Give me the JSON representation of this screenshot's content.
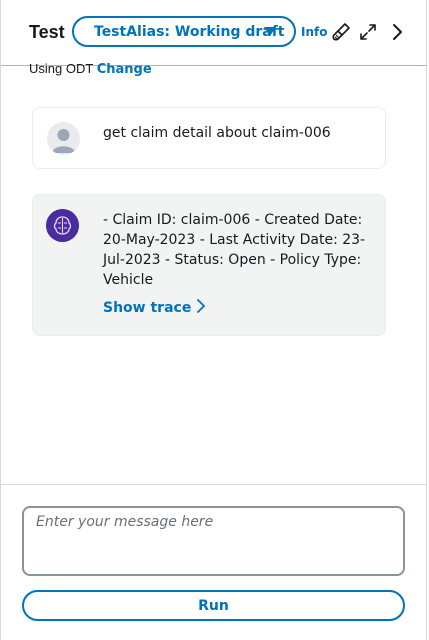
{
  "header": {
    "title": "Test",
    "alias_label": "TestAlias: Working draft",
    "info_label": "Info",
    "icons": [
      "clear-brush-icon",
      "expand-icon",
      "chevron-right-icon"
    ]
  },
  "model_row": {
    "prefix": "Using ODT",
    "change_label": "Change"
  },
  "conversation": {
    "user_message": "get claim detail about claim-006",
    "agent_message": "- Claim ID: claim-006 - Created Date: 20-May-2023 - Last Activity Date: 23-Jul-2023 - Status: Open - Policy Type: Vehicle",
    "show_trace_label": "Show trace"
  },
  "composer": {
    "placeholder": "Enter your message here",
    "run_label": "Run"
  },
  "colors": {
    "accent": "#0073bb",
    "agent_avatar": "#4b2ba0",
    "agent_bubble_bg": "#f2f3f3"
  }
}
